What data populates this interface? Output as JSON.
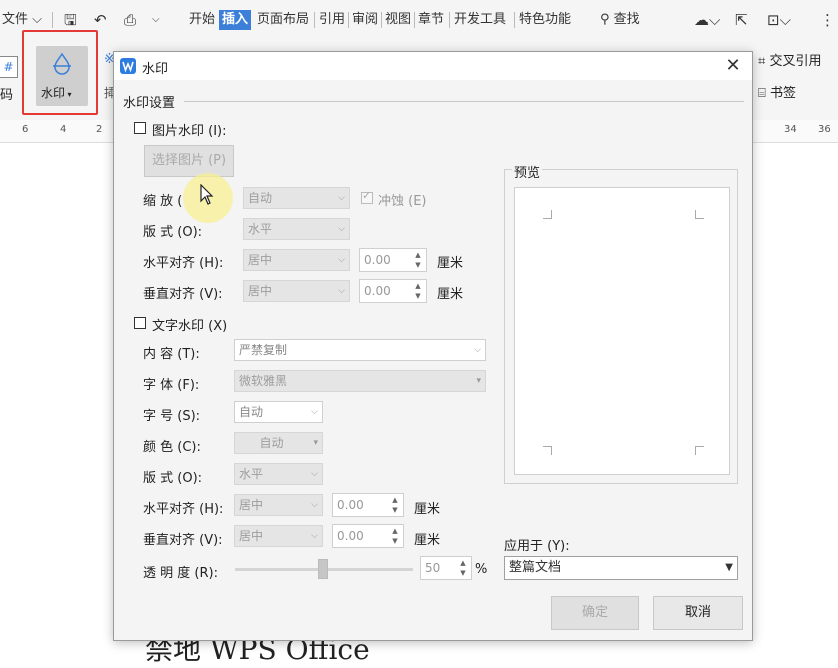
{
  "menubar": {
    "file": "文件",
    "tabs": [
      "开始",
      "插入",
      "页面布局",
      "引用",
      "审阅",
      "视图",
      "章节",
      "开发工具",
      "特色功能"
    ],
    "active_tab": "插入",
    "search": "查找"
  },
  "ribbon": {
    "watermark": "水印",
    "left_partial": "码",
    "cross_ref": "交叉引用",
    "bookmark": "书签",
    "hash_icon_text": "#"
  },
  "ruler": {
    "left_marks": [
      "6",
      "4",
      "2"
    ],
    "right_marks": [
      "34",
      "36"
    ]
  },
  "document": {
    "text": "禁地 WPS Office"
  },
  "dialog": {
    "title": "水印",
    "section": "水印设置",
    "picture": {
      "checkbox_label": "图片水印 (I):",
      "choose_button": "选择图片 (P)",
      "scale_label": "缩  放",
      "scale_value": "自动",
      "washout_label": "冲蚀 (E)",
      "layout_label": "版  式 (O):",
      "layout_value": "水平",
      "h_align_label": "水平对齐 (H):",
      "h_align_value": "居中",
      "h_offset": "0.00",
      "v_align_label": "垂直对齐 (V):",
      "v_align_value": "居中",
      "v_offset": "0.00",
      "unit": "厘米"
    },
    "text": {
      "checkbox_label": "文字水印 (X)",
      "content_label": "内  容 (T):",
      "content_value": "严禁复制",
      "font_label": "字  体 (F):",
      "font_value": "微软雅黑",
      "size_label": "字  号 (S):",
      "size_value": "自动",
      "color_label": "颜  色 (C):",
      "color_value": "自动",
      "layout_label": "版  式 (O):",
      "layout_value": "水平",
      "h_align_label": "水平对齐 (H):",
      "h_align_value": "居中",
      "h_offset": "0.00",
      "v_align_label": "垂直对齐 (V):",
      "v_align_value": "居中",
      "v_offset": "0.00",
      "unit": "厘米",
      "transparency_label": "透 明 度 (R):",
      "transparency_value": "50",
      "transparency_unit": "%"
    },
    "preview_label": "预览",
    "apply_label": "应用于 (Y):",
    "apply_value": "整篇文档",
    "ok": "确定",
    "cancel": "取消"
  },
  "colors": {
    "accent": "#3b7fd8",
    "highlight": "#e53935",
    "dialog_bg": "#f4f4f4"
  }
}
